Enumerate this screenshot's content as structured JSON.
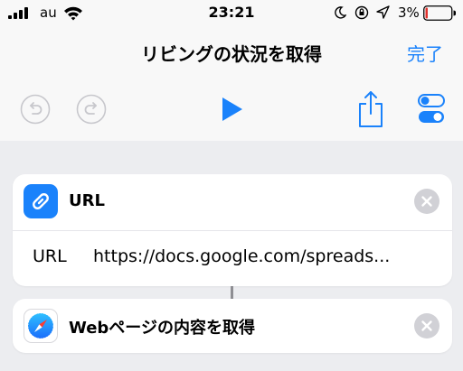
{
  "status_bar": {
    "carrier": "au",
    "time": "23:21",
    "battery_percent": "3%"
  },
  "nav": {
    "title": "リビングの状況を取得",
    "done_label": "完了"
  },
  "toolbar": {
    "icons": [
      "undo-icon",
      "redo-icon",
      "play-icon",
      "share-icon",
      "settings-toggle-icon"
    ],
    "accent_color": "#1a82fb"
  },
  "actions": [
    {
      "title": "URL",
      "icon": "link-icon",
      "field_label": "URL",
      "field_value": "https://docs.google.com/spreads..."
    },
    {
      "title": "Webページの内容を取得",
      "icon": "safari-compass-icon"
    }
  ]
}
